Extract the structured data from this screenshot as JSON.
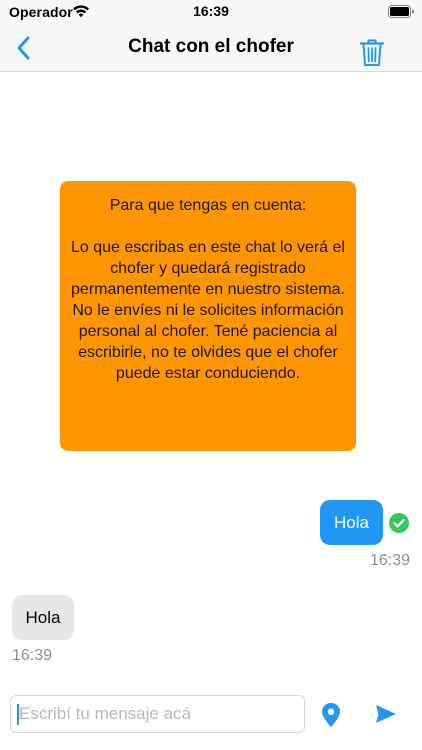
{
  "status_bar": {
    "carrier": "Operador",
    "time": "16:39"
  },
  "nav": {
    "title": "Chat con el chofer"
  },
  "notice": {
    "title": "Para que tengas en cuenta:",
    "body": "Lo que escribas en este chat lo verá el chofer y quedará registrado permanentemente en nuestro sistema. No le envíes ni le solicites información personal al chofer. Tené paciencia al escribirle, no te olvides que el chofer puede estar conduciendo."
  },
  "messages": [
    {
      "direction": "sent",
      "text": "Hola",
      "time": "16:39",
      "status": "read"
    },
    {
      "direction": "received",
      "text": "Hola",
      "time": "16:39"
    }
  ],
  "composer": {
    "value": "",
    "placeholder": "Escribí tu mensaje acá"
  },
  "icons": {
    "back": "chevron-left-icon",
    "trash": "trash-icon",
    "check": "check-circle-icon",
    "location": "location-pin-icon",
    "send": "send-icon"
  },
  "colors": {
    "accent": "#2196f3",
    "notice_bg": "#ff9500",
    "received_bg": "#e6e6e8",
    "check": "#34c759",
    "timestamp": "#8e8e93"
  }
}
